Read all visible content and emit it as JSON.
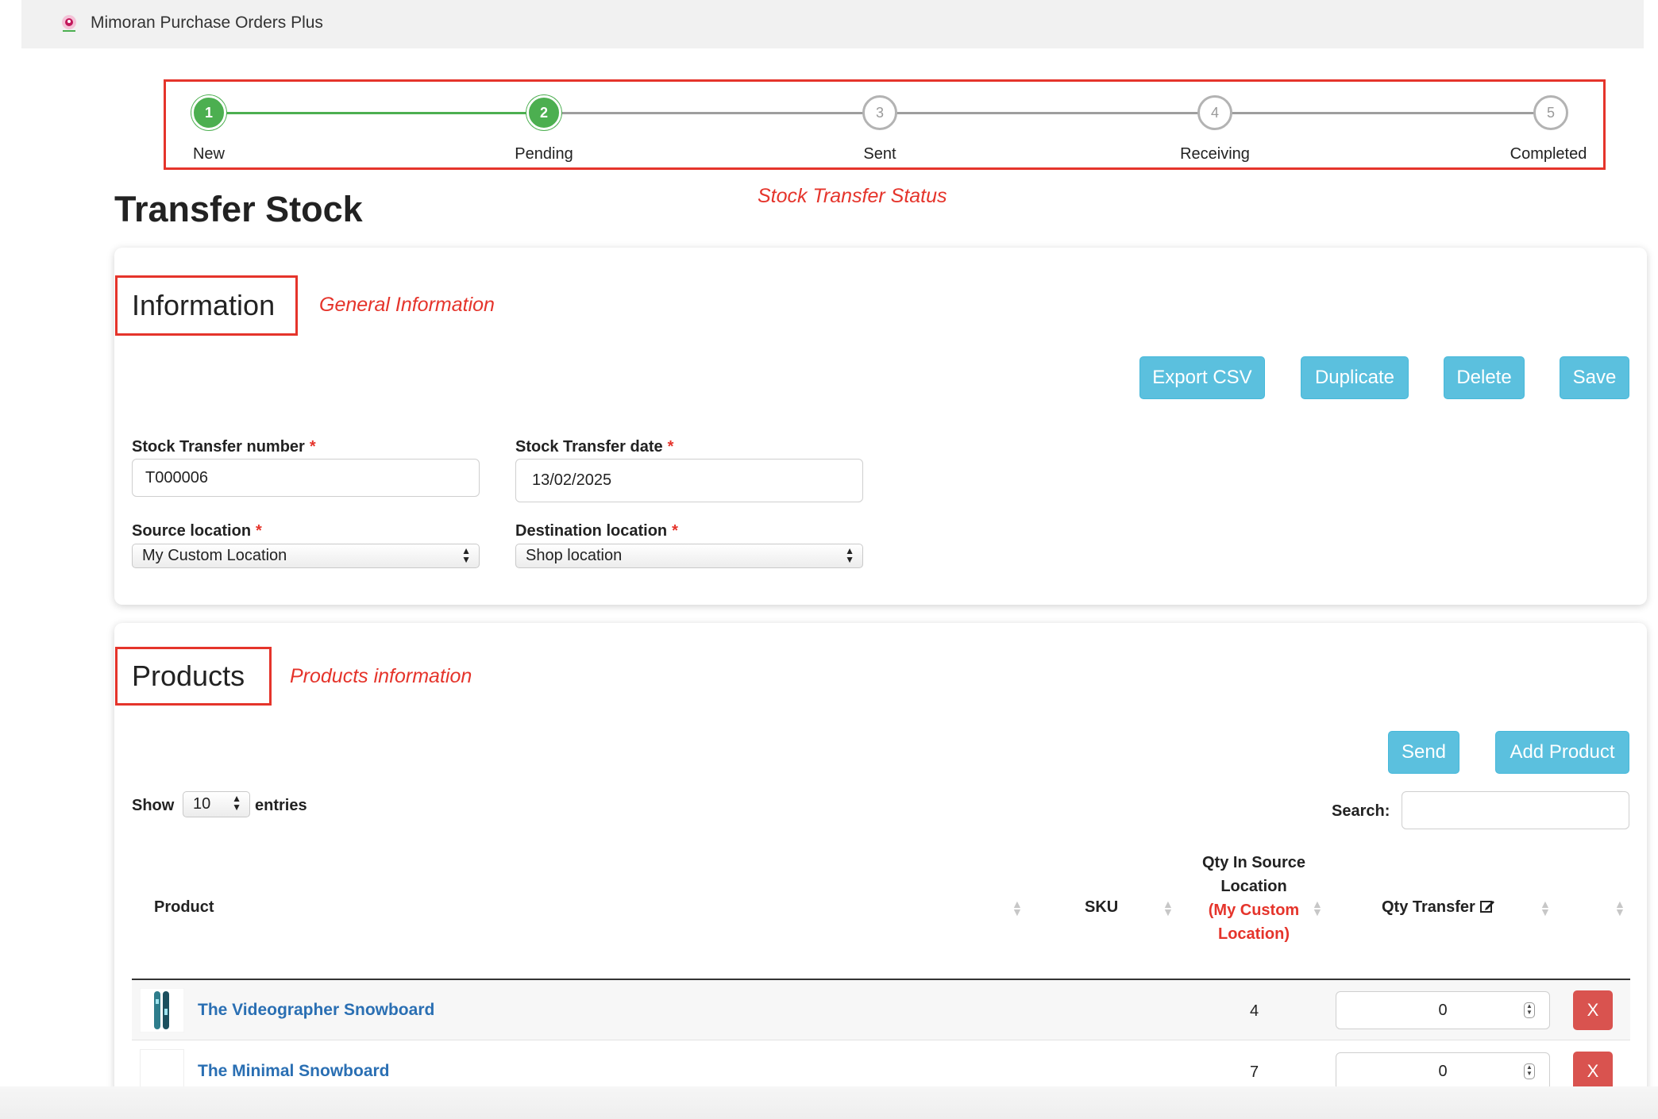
{
  "app": {
    "title": "Mimoran Purchase Orders Plus"
  },
  "stepper": {
    "steps": [
      {
        "number": "1",
        "label": "New",
        "state": "done"
      },
      {
        "number": "2",
        "label": "Pending",
        "state": "done"
      },
      {
        "number": "3",
        "label": "Sent",
        "state": "todo"
      },
      {
        "number": "4",
        "label": "Receiving",
        "state": "todo"
      },
      {
        "number": "5",
        "label": "Completed",
        "state": "todo"
      }
    ],
    "annotation": "Stock Transfer Status"
  },
  "page": {
    "title": "Transfer Stock"
  },
  "information": {
    "heading": "Information",
    "annotation": "General Information",
    "buttons": {
      "export": "Export CSV",
      "duplicate": "Duplicate",
      "delete": "Delete",
      "save": "Save"
    },
    "fields": {
      "number_label": "Stock Transfer number",
      "number_value": "T000006",
      "date_label": "Stock Transfer date",
      "date_value": "13/02/2025",
      "source_label": "Source location",
      "source_value": "My Custom Location",
      "dest_label": "Destination location",
      "dest_value": "Shop location",
      "required_mark": "*"
    }
  },
  "products": {
    "heading": "Products",
    "annotation": "Products information",
    "buttons": {
      "send": "Send",
      "add": "Add Product"
    },
    "show_label": "Show",
    "entries_value": "10",
    "entries_label": "entries",
    "search_label": "Search:",
    "columns": {
      "product": "Product",
      "sku": "SKU",
      "qty_source": "Qty In Source Location",
      "qty_source_loc": "(My Custom Location)",
      "qty_transfer": "Qty Transfer"
    },
    "rows": [
      {
        "name": "The Videographer Snowboard",
        "sku": "",
        "qty_source": "4",
        "qty_transfer": "0",
        "remove": "X"
      },
      {
        "name": "The Minimal Snowboard",
        "sku": "",
        "qty_source": "7",
        "qty_transfer": "0",
        "remove": "X"
      }
    ]
  },
  "colors": {
    "accent": "#5bc0de",
    "success": "#4caf50",
    "danger": "#d9534f",
    "annotation": "#e5342b",
    "link": "#2a6fb3"
  }
}
